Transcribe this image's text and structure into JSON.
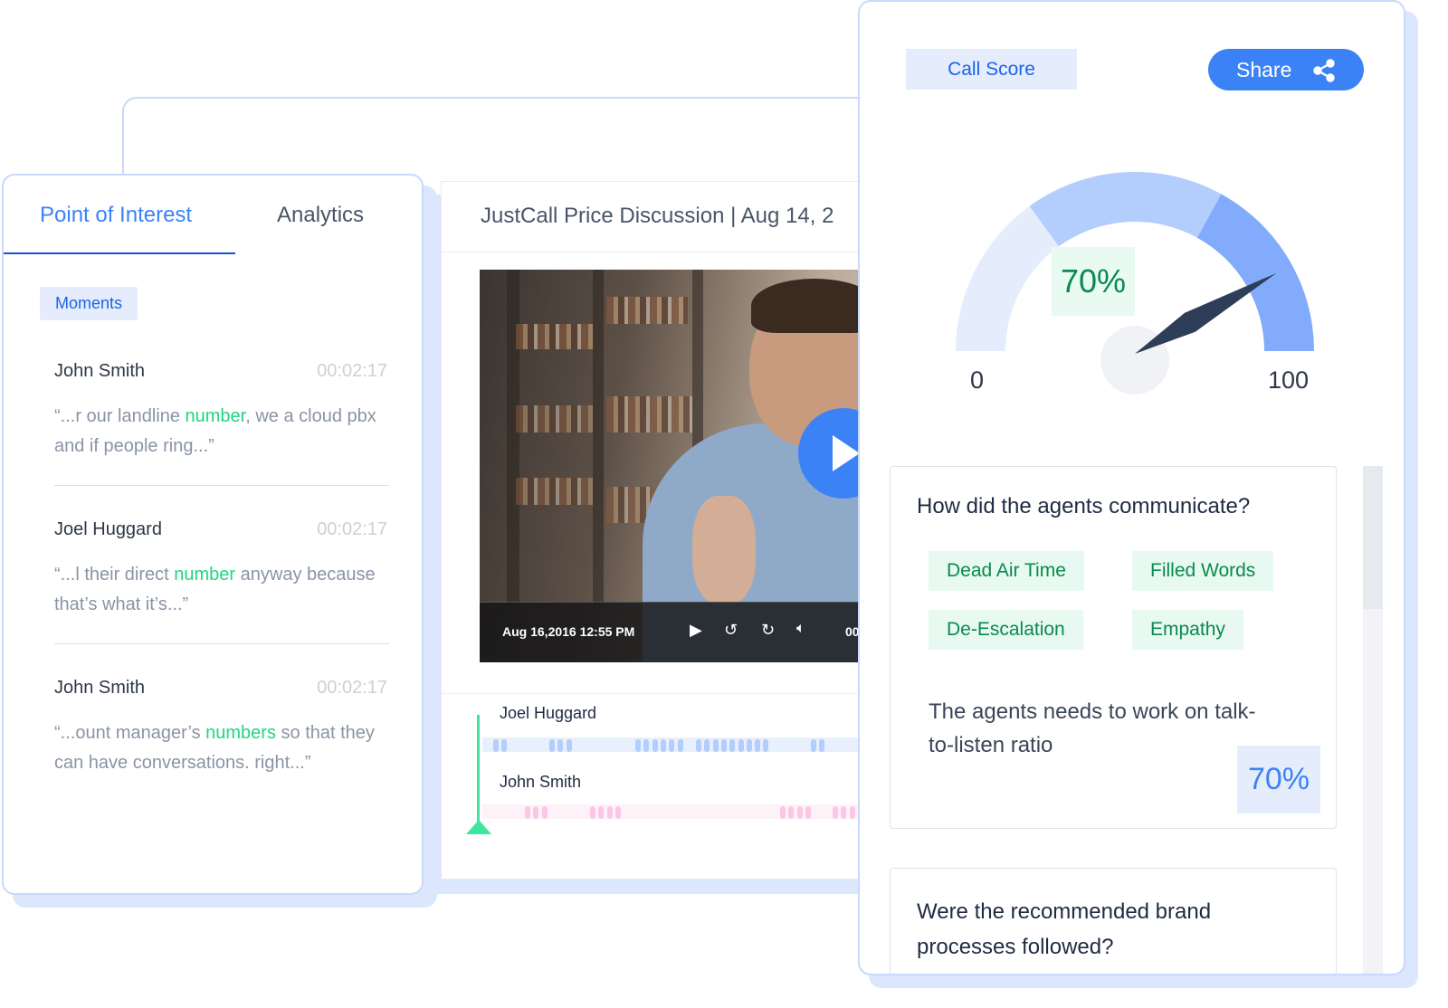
{
  "left_panel": {
    "tabs": [
      {
        "label": "Point of Interest",
        "active": true
      },
      {
        "label": "Analytics",
        "active": false
      }
    ],
    "filter_chip": "Moments",
    "moments": [
      {
        "speaker": "John Smith",
        "time": "00:02:17",
        "quote_pre": "“...r our landline ",
        "keyword": "number",
        "quote_post": ", we a cloud pbx and if people ring...”"
      },
      {
        "speaker": "Joel Huggard",
        "time": "00:02:17",
        "quote_pre": "“...l their direct ",
        "keyword": "number",
        "quote_post": " anyway because that’s what it’s...”"
      },
      {
        "speaker": "John Smith",
        "time": "00:02:17",
        "quote_pre": "“...ount manager’s ",
        "keyword": "numbers",
        "quote_post": " so that they can have conversations. right...”"
      }
    ]
  },
  "call": {
    "title": "JustCall Price Discussion | Aug 14, 2",
    "video": {
      "timestamp": "Aug 16,2016 12:55 PM",
      "time_partial": "00",
      "icons": [
        "play-icon",
        "rewind-5-icon",
        "forward-5-icon",
        "volume-icon"
      ]
    },
    "timeline": [
      {
        "speaker": "Joel Huggard",
        "color": "#b3cdfc",
        "track_color": "#e8effd"
      },
      {
        "speaker": "John Smith",
        "color": "#fcc7e6",
        "track_color": "#fdf2f8"
      }
    ]
  },
  "score_panel": {
    "call_score_label": "Call Score",
    "share_label": "Share",
    "gauge": {
      "value": 70,
      "value_label": "70%",
      "min_label": "0",
      "max_label": "100",
      "segment_colors": [
        "#e5edfd",
        "#b3cdfc",
        "#82abfb"
      ]
    },
    "cards": [
      {
        "question": "How did the agents communicate?",
        "tags": [
          "Dead Air Time",
          "Filled Words",
          "De-Escalation",
          "Empathy"
        ],
        "note": "The agents needs to work on talk-to-listen ratio",
        "percent": "70%"
      },
      {
        "question": "Were the recommended brand processes followed?"
      }
    ]
  },
  "colors": {
    "accent": "#3b82f6",
    "highlight": "#1fd67f",
    "tag_text": "#0a8a4e"
  }
}
